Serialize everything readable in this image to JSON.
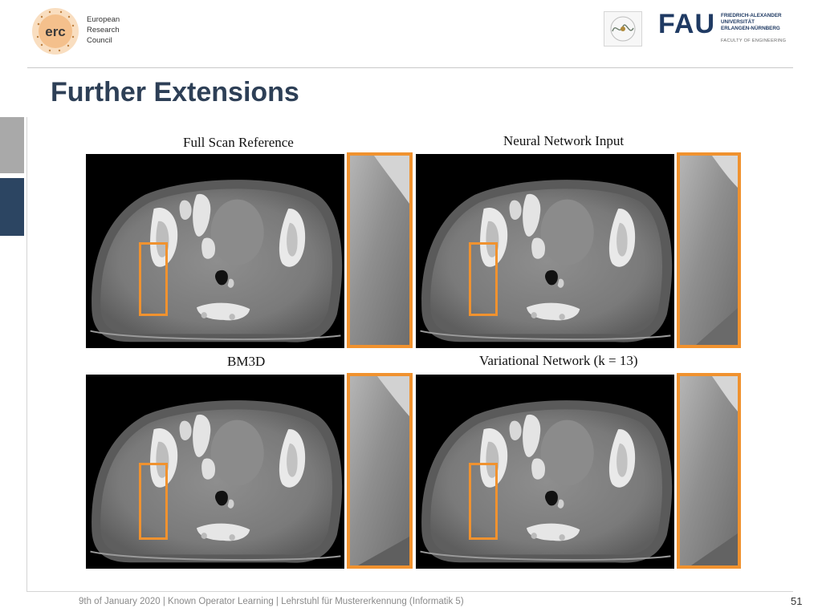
{
  "header": {
    "erc": {
      "logo_text": "erc",
      "lines": [
        "European",
        "Research",
        "Council"
      ]
    },
    "fau": {
      "word": "FAU",
      "lines": [
        "FRIEDRICH-ALEXANDER",
        "UNIVERSITÄT",
        "ERLANGEN-NÜRNBERG"
      ],
      "sub": "FACULTY OF ENGINEERING"
    }
  },
  "title": "Further Extensions",
  "panels": [
    {
      "caption": "Full Scan Reference"
    },
    {
      "caption": "Neural Network Input"
    },
    {
      "caption": "BM3D"
    },
    {
      "caption": "Variational Network (k = 13)"
    }
  ],
  "footer": {
    "text": "9th of January 2020  |  Known Operator Learning  |   Lehrstuhl für Mustererkennung (Informatik 5)",
    "page": "51"
  },
  "colors": {
    "title": "#2d3f56",
    "accent_orange": "#f0922f",
    "tab_gray": "#a9a9a9",
    "tab_navy": "#2c4562"
  }
}
